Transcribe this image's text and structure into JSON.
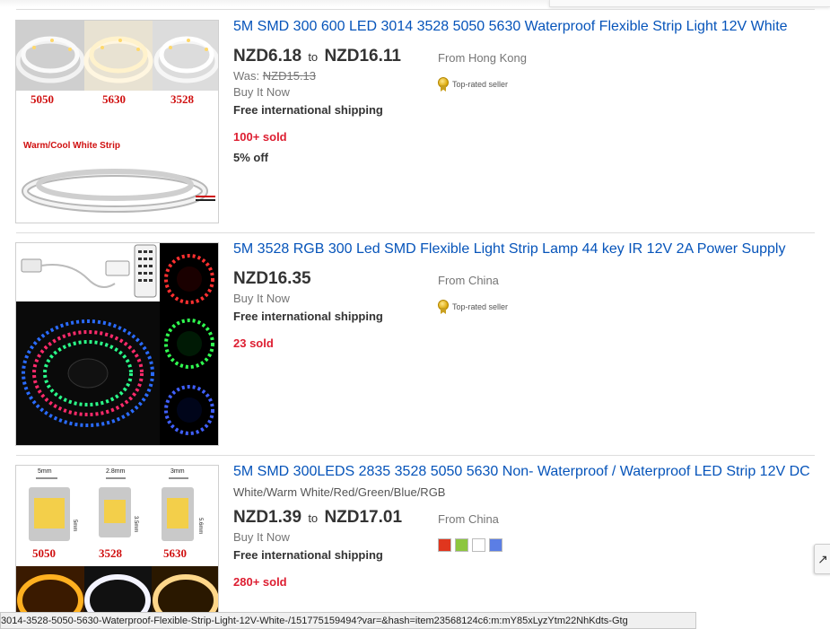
{
  "items": [
    {
      "title": "5M SMD 300 600 LED 3014 3528 5050 5630 Waterproof Flexible Strip Light 12V White",
      "price_low": "NZD6.18",
      "price_to": "to",
      "price_high": "NZD16.11",
      "was_label": "Was:",
      "was_price": "NZD15.13",
      "format": "Buy It Now",
      "shipping": "Free international shipping",
      "sold": "100+ sold",
      "discount": "5% off",
      "origin": "From Hong Kong",
      "badge": "Top-rated seller",
      "thumb": {
        "labels": [
          "5050",
          "5630",
          "3528"
        ],
        "band": "Warm/Cool White Strip"
      }
    },
    {
      "title": "5M 3528 RGB 300 Led SMD Flexible Light Strip Lamp 44 key IR 12V 2A Power Supply",
      "price": "NZD16.35",
      "format": "Buy It Now",
      "shipping": "Free international shipping",
      "sold": "23 sold",
      "origin": "From China",
      "badge": "Top-rated seller"
    },
    {
      "title": "5M SMD 300LEDS 2835 3528 5050 5630 Non- Waterproof / Waterproof LED Strip 12V DC",
      "subtitle": "White/Warm White/Red/Green/Blue/RGB",
      "price_low": "NZD1.39",
      "price_to": "to",
      "price_high": "NZD17.01",
      "format": "Buy It Now",
      "shipping": "Free international shipping",
      "sold": "280+ sold",
      "origin": "From China",
      "swatches": [
        "#e0361e",
        "#8cc63f",
        "#ffffff",
        "#5b7ee5"
      ],
      "thumb": {
        "dims": [
          "5mm",
          "2.8mm",
          "3mm"
        ],
        "side_dims": [
          "5mm",
          "3.5mm",
          "5.6mm"
        ],
        "labels": [
          "5050",
          "3528",
          "5630"
        ]
      }
    }
  ],
  "status_url": "3014-3528-5050-5630-Waterproof-Flexible-Strip-Light-12V-White-/151775159494?var=&hash=item23568124c6:m:mY85xLyzYtm22NhKdts-Gtg",
  "side_tab_icon": "arrow-icon",
  "colors": {
    "link": "#0654ba",
    "sold": "#dd1e31"
  }
}
